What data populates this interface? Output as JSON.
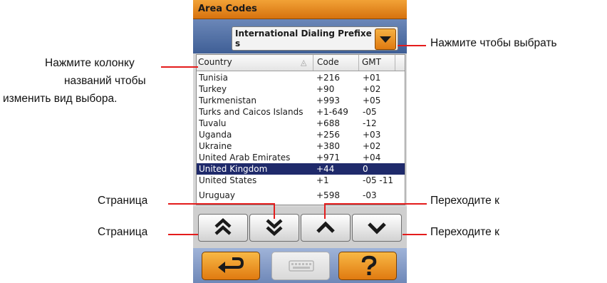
{
  "window": {
    "title": "Area Codes"
  },
  "selector": {
    "value": "International Dialing Prefixes",
    "button_icon": "dropdown-arrow-icon",
    "accent": "#f08a1c"
  },
  "table": {
    "columns": [
      {
        "label": "Country",
        "sort_icon": "sort-ascending-icon"
      },
      {
        "label": "Code"
      },
      {
        "label": "GMT"
      }
    ],
    "rows": [
      {
        "country": "Tunisia",
        "code": "+216",
        "gmt": "+01"
      },
      {
        "country": "Turkey",
        "code": "+90",
        "gmt": "+02"
      },
      {
        "country": "Turkmenistan",
        "code": "+993",
        "gmt": "+05"
      },
      {
        "country": "Turks and Caicos Islands",
        "code": "+1-649",
        "gmt": "-05"
      },
      {
        "country": "Tuvalu",
        "code": "+688",
        "gmt": "-12"
      },
      {
        "country": "Uganda",
        "code": "+256",
        "gmt": "+03"
      },
      {
        "country": "Ukraine",
        "code": "+380",
        "gmt": "+02"
      },
      {
        "country": "United Arab Emirates",
        "code": "+971",
        "gmt": "+04"
      },
      {
        "country": "United Kingdom",
        "code": "+44",
        "gmt": "0",
        "selected": true
      },
      {
        "country": "United States",
        "code": "+1",
        "gmt": "-05 -11"
      },
      {
        "country": "Uruguay",
        "code": "+598",
        "gmt": "-03"
      }
    ],
    "selected_row_color": "#1f2a6b"
  },
  "nav_buttons": [
    {
      "icon": "page-up-icon"
    },
    {
      "icon": "page-down-icon"
    },
    {
      "icon": "arrow-up-icon"
    },
    {
      "icon": "arrow-down-icon"
    }
  ],
  "bottom_buttons": [
    {
      "icon": "back-arrow-icon",
      "accent": "#f08a1c"
    },
    {
      "icon": "keyboard-icon",
      "disabled": true
    },
    {
      "icon": "help-icon",
      "accent": "#f08a1c"
    }
  ],
  "callouts": {
    "select": "Нажмите чтобы выбрать",
    "column_line1": "Нажмите колонку",
    "column_line2": "названий чтобы",
    "column_line3": "изменить вид выбора.",
    "page_down": "Страница",
    "page_up": "Страница",
    "move_up": "Переходите к",
    "move_down": "Переходите к"
  }
}
